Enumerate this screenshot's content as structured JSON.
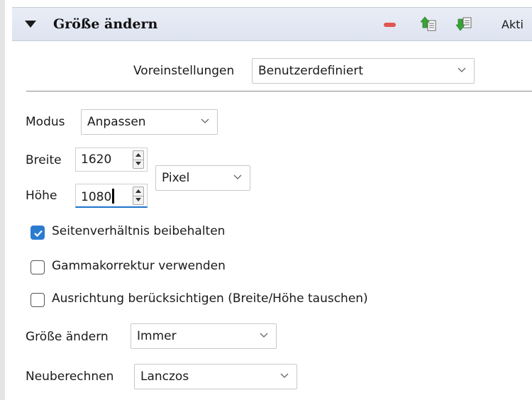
{
  "header": {
    "title": "Größe ändern",
    "active_label": "Akti"
  },
  "presets": {
    "label": "Voreinstellungen",
    "value": "Benutzerdefiniert"
  },
  "mode": {
    "label": "Modus",
    "value": "Anpassen"
  },
  "width": {
    "label": "Breite",
    "value": "1620"
  },
  "height": {
    "label": "Höhe",
    "value": "1080"
  },
  "unit": {
    "value": "Pixel"
  },
  "checkboxes": [
    {
      "label": "Seitenverhältnis beibehalten",
      "checked": true
    },
    {
      "label": "Gammakorrektur verwenden",
      "checked": false
    },
    {
      "label": "Ausrichtung berücksichtigen (Breite/Höhe tauschen)",
      "checked": false
    }
  ],
  "resize": {
    "label": "Größe ändern",
    "value": "Immer"
  },
  "resample": {
    "label": "Neuberechnen",
    "value": "Lanczos"
  },
  "colors": {
    "accent": "#2b7bd1",
    "header_bg": "#dde3f0",
    "minus": "#e0574f",
    "arrow_green": "#3aa335"
  }
}
